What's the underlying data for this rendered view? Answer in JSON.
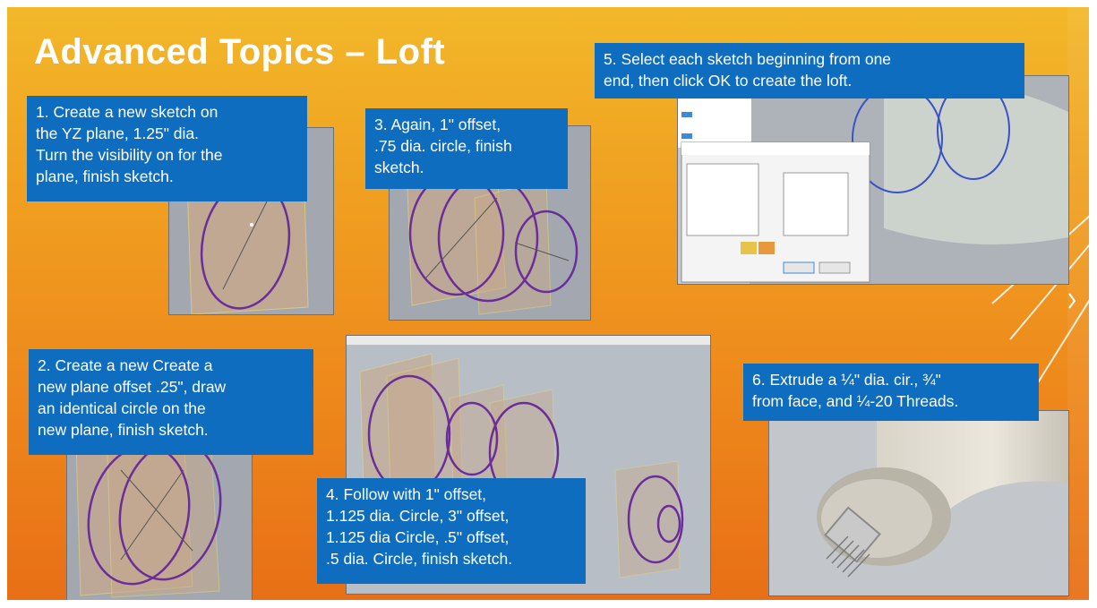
{
  "slide": {
    "title": "Advanced Topics – Loft",
    "steps": [
      {
        "lines": [
          "1. Create a new sketch on",
          "the YZ plane, 1.25\" dia.",
          "Turn the visibility on for the",
          "plane, finish sketch."
        ]
      },
      {
        "lines": [
          "2. Create a new Create a",
          "new plane offset .25\", draw",
          "an identical circle on the",
          "new plane, finish sketch."
        ]
      },
      {
        "lines": [
          "3. Again, 1\" offset,",
          ".75 dia. circle, finish",
          "sketch."
        ]
      },
      {
        "lines": [
          "4. Follow with 1\" offset,",
          "1.125 dia. Circle, 3\" offset,",
          "1.125 dia Circle, .5\" offset,",
          ".5 dia. Circle, finish sketch."
        ]
      },
      {
        "lines": [
          "5. Select each sketch beginning from one",
          "end, then click OK to create the loft."
        ]
      },
      {
        "lines": [
          "6. Extrude a ¼\" dia. cir., ¾\"",
          "from face, and ¼-20 Threads."
        ]
      }
    ]
  }
}
